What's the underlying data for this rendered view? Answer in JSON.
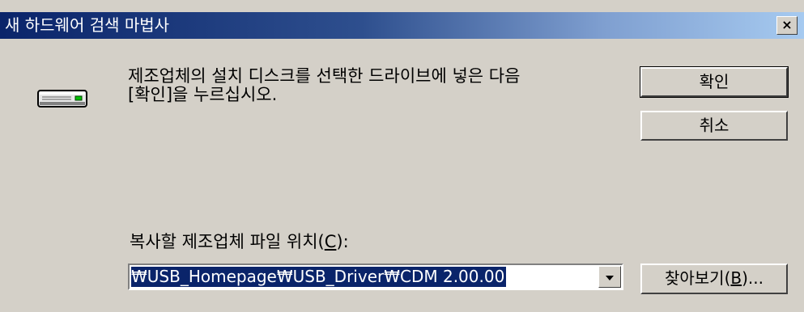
{
  "window": {
    "title": "새 하드웨어 검색 마법사",
    "close_glyph": "×"
  },
  "icon": {
    "name": "disk-drive-icon"
  },
  "message": {
    "line1": "제조업체의 설치 디스크를 선택한 드라이브에 넣은 다음",
    "line2": "[확인]을 누르십시오."
  },
  "buttons": {
    "ok_label": "확인",
    "cancel_label": "취소",
    "browse_label_prefix": "찾아보기(",
    "browse_mnemonic": "B",
    "browse_label_suffix": ")..."
  },
  "location": {
    "label_prefix": "복사할 제조업체 파일 위치(",
    "label_mnemonic": "C",
    "label_suffix": "):",
    "value": "₩USB_Homepage₩USB_Driver₩CDM 2.00.00"
  },
  "colors": {
    "titlebar_start": "#0a246a",
    "titlebar_end": "#a6caf0",
    "dialog_face": "#d4d0c8",
    "selection": "#0a246a"
  }
}
